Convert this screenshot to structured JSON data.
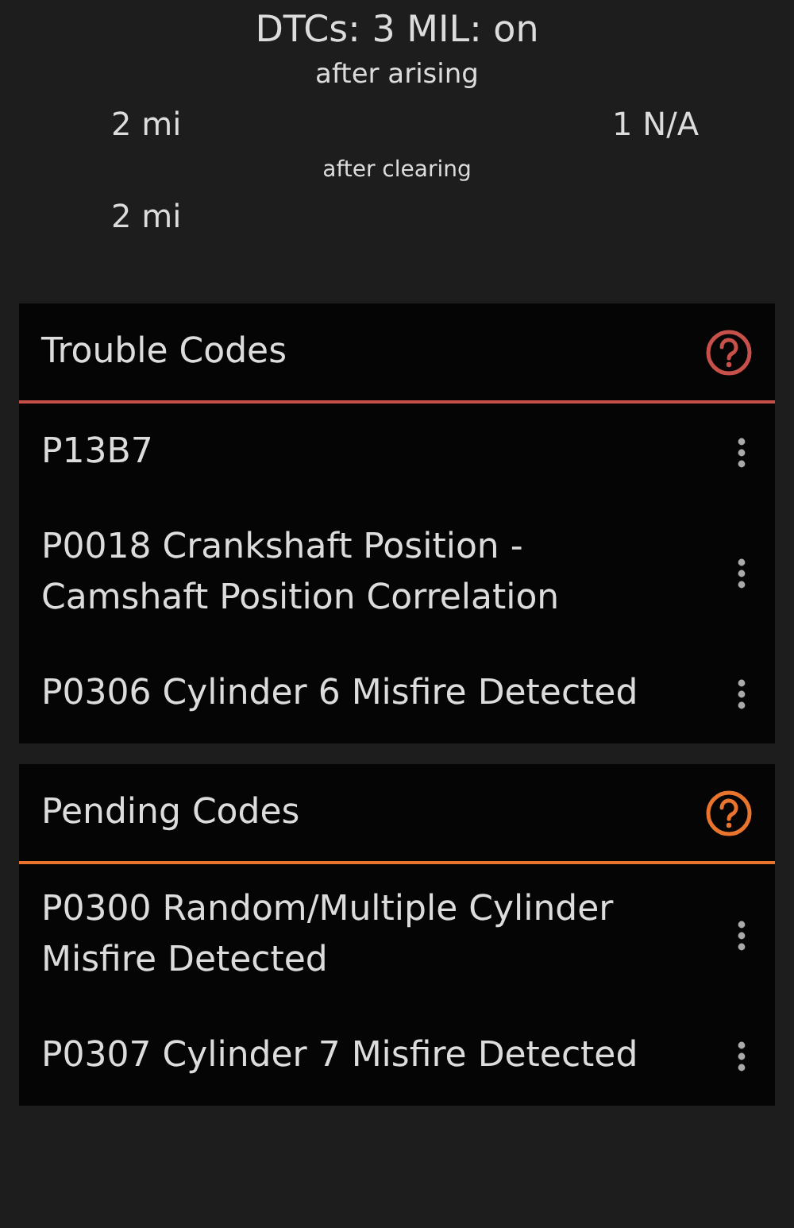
{
  "summary": {
    "title": "DTCs: 3 MIL: on",
    "after_arising_label": "after arising",
    "after_arising_distance": "2 mi",
    "after_arising_count": "1 N/A",
    "after_clearing_label": "after clearing",
    "after_clearing_distance": "2 mi"
  },
  "sections": [
    {
      "title": "Trouble Codes",
      "color": "#c8504a",
      "codes": [
        "P13B7",
        "P0018 Crankshaft Position - Camshaft Position Correlation",
        "P0306 Cylinder 6 Misfire Detected"
      ]
    },
    {
      "title": "Pending Codes",
      "color": "#e8742e",
      "codes": [
        "P0300 Random/Multiple Cylinder Misfire Detected",
        "P0307 Cylinder 7 Misfire Detected"
      ]
    }
  ]
}
